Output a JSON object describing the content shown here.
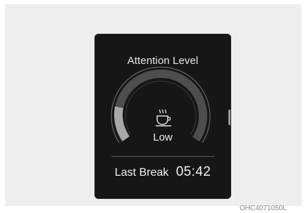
{
  "widget": {
    "title": "Attention Level",
    "level_label": "Low",
    "level_fraction": 0.18,
    "icon": "coffee-cup-icon",
    "last_break_label": "Last Break",
    "last_break_time": "05:42"
  },
  "colors": {
    "panel_background": "#161616",
    "gauge_fill": "#a8a8a8",
    "gauge_track": "#555555",
    "text": "#f0f0f0"
  },
  "figure_code": "OHC4071050L"
}
